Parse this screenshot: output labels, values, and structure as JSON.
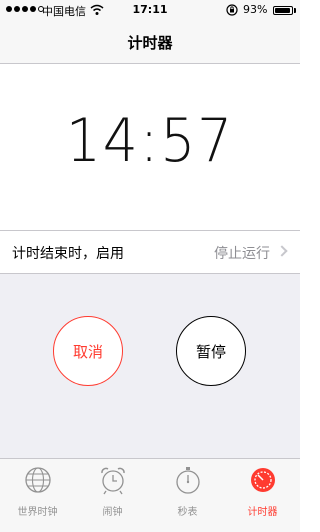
{
  "status_bar": {
    "carrier": "中国电信",
    "time": "17:11",
    "battery": "93%",
    "battery_level": 0.93
  },
  "nav": {
    "title": "计时器"
  },
  "timer": {
    "display": "14:57"
  },
  "row": {
    "label": "计时结束时，启用",
    "value": "停止运行"
  },
  "buttons": {
    "cancel": "取消",
    "pause": "暂停"
  },
  "tabs": [
    {
      "label": "世界时钟",
      "icon": "globe-icon"
    },
    {
      "label": "闹钟",
      "icon": "alarm-clock-icon"
    },
    {
      "label": "秒表",
      "icon": "stopwatch-icon"
    },
    {
      "label": "计时器",
      "icon": "timer-icon",
      "active": true
    }
  ],
  "colors": {
    "accent_red": "#ff3b30",
    "background_gray": "#efeff4"
  }
}
